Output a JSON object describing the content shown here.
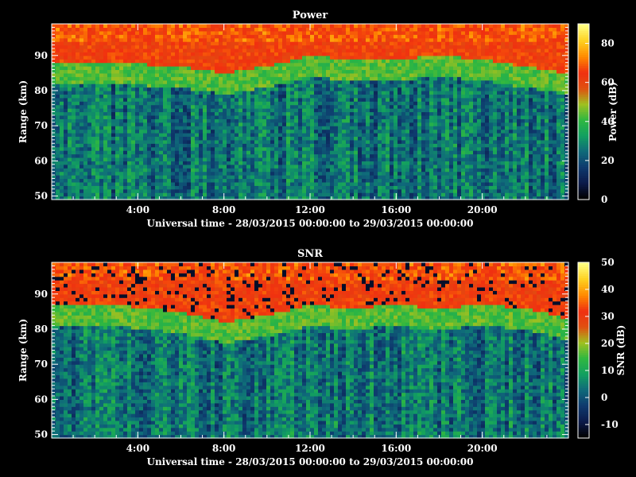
{
  "chart_data": [
    {
      "type": "heatmap",
      "title": "Power",
      "xlabel": "Universal time - 28/03/2015 00:00:00 to 29/03/2015 00:00:00",
      "ylabel": "Range (km)",
      "colorbar_label": "Power (dB)",
      "x_ticks": [
        "4:00",
        "8:00",
        "12:00",
        "16:00",
        "20:00"
      ],
      "x_tick_hours": [
        4,
        8,
        12,
        16,
        20
      ],
      "y_ticks": [
        50,
        60,
        70,
        80,
        90
      ],
      "colorbar_ticks": [
        0,
        20,
        40,
        60,
        80
      ],
      "xlim_hours": [
        0,
        24
      ],
      "ylim": [
        49,
        99
      ],
      "zlim": [
        0,
        90
      ],
      "boundary_km": [
        [
          0,
          85
        ],
        [
          3,
          85
        ],
        [
          6,
          84
        ],
        [
          8,
          82
        ],
        [
          10,
          84
        ],
        [
          12,
          87
        ],
        [
          14,
          86
        ],
        [
          16,
          86
        ],
        [
          18,
          87
        ],
        [
          20,
          86
        ],
        [
          22,
          84
        ],
        [
          24,
          82
        ]
      ]
    },
    {
      "type": "heatmap",
      "title": "SNR",
      "xlabel": "Universal time - 28/03/2015 00:00:00 to 29/03/2015 00:00:00",
      "ylabel": "Range (km)",
      "colorbar_label": "SNR (dB)",
      "x_ticks": [
        "4:00",
        "8:00",
        "12:00",
        "16:00",
        "20:00"
      ],
      "x_tick_hours": [
        4,
        8,
        12,
        16,
        20
      ],
      "y_ticks": [
        50,
        60,
        70,
        80,
        90
      ],
      "colorbar_ticks": [
        -10,
        0,
        10,
        20,
        30,
        40,
        50
      ],
      "xlim_hours": [
        0,
        24
      ],
      "ylim": [
        49,
        99
      ],
      "zlim": [
        -15,
        50
      ],
      "boundary_km": [
        [
          0,
          84
        ],
        [
          3,
          84
        ],
        [
          6,
          82
        ],
        [
          8,
          79
        ],
        [
          10,
          81
        ],
        [
          12,
          84
        ],
        [
          14,
          83
        ],
        [
          16,
          84
        ],
        [
          18,
          83
        ],
        [
          20,
          84
        ],
        [
          22,
          83
        ],
        [
          24,
          80
        ]
      ]
    }
  ],
  "colormap": [
    "#000000",
    "#0b1a4a",
    "#0e3a6e",
    "#0f6a7a",
    "#12a060",
    "#30b840",
    "#a0c020",
    "#e05010",
    "#f03010",
    "#ff8a00",
    "#ffd020",
    "#ffff80"
  ]
}
